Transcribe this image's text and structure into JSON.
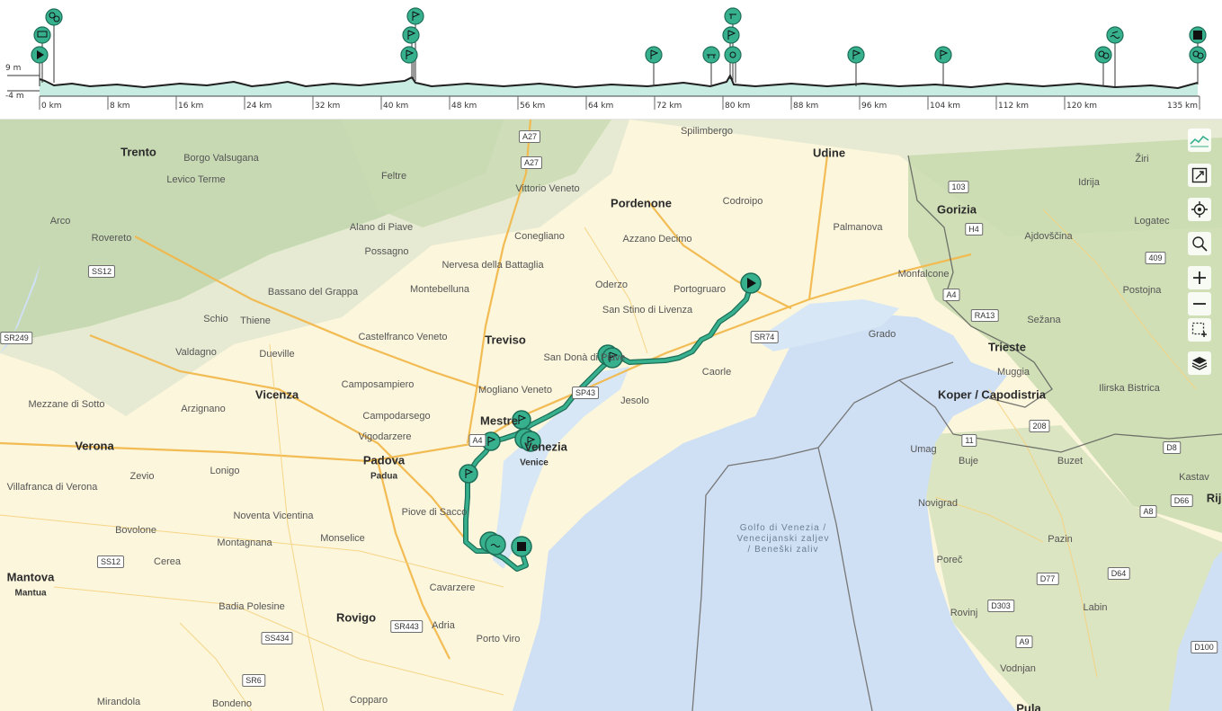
{
  "profile": {
    "y_labels": {
      "top": "9 m",
      "bottom": "-4 m"
    },
    "x_labels": [
      "0 km",
      "8 km",
      "16 km",
      "24 km",
      "32 km",
      "40 km",
      "48 km",
      "56 km",
      "64 km",
      "72 km",
      "80 km",
      "88 km",
      "96 km",
      "104 km",
      "112 km",
      "120 km",
      "135 km"
    ],
    "fill_color": "#c8ece2",
    "line_color": "#1f1f1f"
  },
  "map": {
    "route_color": "#37b08e",
    "water_color": "#cfe0f4",
    "places": {
      "trento": "Trento",
      "borgo": "Borgo Valsugana",
      "levico": "Levico Terme",
      "feltre": "Feltre",
      "vittorio": "Vittorio Veneto",
      "spilimbergo": "Spilimbergo",
      "udine": "Udine",
      "gorizia": "Gorizia",
      "arco": "Arco",
      "rovereto": "Rovereto",
      "alano": "Alano di Piave",
      "possagno": "Possagno",
      "conegliano": "Conegliano",
      "pordenone": "Pordenone",
      "codroipo": "Codroipo",
      "azzano": "Azzano Decimo",
      "palmanova": "Palmanova",
      "nervesa": "Nervesa della Battaglia",
      "bassano": "Bassano del Grappa",
      "montebelluna": "Montebelluna",
      "oderzo": "Oderzo",
      "portogruaro": "Portogruaro",
      "monfalcone": "Monfalcone",
      "schio": "Schio",
      "thiene": "Thiene",
      "sanstino": "San Stino di Livenza",
      "castelfranco": "Castelfranco Veneto",
      "treviso": "Treviso",
      "valdagno": "Valdagno",
      "dueville": "Dueville",
      "sandona": "San Donà di Piave",
      "caorle": "Caorle",
      "grado": "Grado",
      "trieste": "Trieste",
      "muggia": "Muggia",
      "camposampiero": "Camposampiero",
      "vicenza": "Vicenza",
      "mogliano": "Mogliano Veneto",
      "jesolo": "Jesolo",
      "koper": "Koper / Capodistria",
      "mezzane": "Mezzane di Sotto",
      "arzignano": "Arzignano",
      "campodarsego": "Campodarsego",
      "mestre": "Mestre",
      "venezia": "Venezia",
      "venice": "Venice",
      "verona": "Verona",
      "vigodarzere": "Vigodarzere",
      "padova": "Padova",
      "padua": "Padua",
      "umag": "Umag",
      "buje": "Buje",
      "lonigo": "Lonigo",
      "zevio": "Zevio",
      "villafranca": "Villafranca di Verona",
      "noventa": "Noventa Vicentina",
      "piove": "Piove di Sacco",
      "novigrad": "Novigrad",
      "bovolone": "Bovolone",
      "montagnana": "Montagnana",
      "monselice": "Monselice",
      "porec": "Poreč",
      "mantova": "Mantova",
      "mantua": "Mantua",
      "cerea": "Cerea",
      "cavarzere": "Cavarzere",
      "badia": "Badia Polesine",
      "rovigo": "Rovigo",
      "adria": "Adria",
      "portoviro": "Porto Viro",
      "mirandola": "Mirandola",
      "bondeno": "Bondeno",
      "copparo": "Copparo",
      "rovinj": "Rovinj",
      "vodnjan": "Vodnjan",
      "labin": "Labin",
      "pazin": "Pazin",
      "buzet": "Buzet",
      "idrija": "Idrija",
      "ajdovscina": "Ajdovščina",
      "sezana": "Sežana",
      "postojna": "Postojna",
      "ilirska": "Ilirska Bistrica",
      "logatec": "Logatec",
      "ziri": "Žiri",
      "kastav": "Kastav",
      "rij": "Rij",
      "pula": "Pula",
      "gulf": "Golfo di Venezia /\nVenecijanski zaljev\n/ Beneški zaliv"
    },
    "shields": {
      "a27a": "A27",
      "a27b": "A27",
      "ss12a": "SS12",
      "sr249": "SR249",
      "a4": "A4",
      "ra13": "RA13",
      "h4": "H4",
      "n103": "103",
      "n409": "409",
      "sr74": "SR74",
      "sp43": "SP43",
      "a4b": "A4",
      "n208": "208",
      "n11": "11",
      "d8": "D8",
      "d66": "D66",
      "a8": "A8",
      "ss12b": "SS12",
      "d64": "D64",
      "d77": "D77",
      "d303": "D303",
      "a9": "A9",
      "d100": "D100",
      "sr443": "SR443",
      "ss434": "SS434",
      "sr6": "SR6"
    },
    "controls": [
      "elevation-toggle",
      "fullscreen",
      "locate",
      "search",
      "zoom-in",
      "zoom-out",
      "select-area",
      "layers"
    ]
  }
}
